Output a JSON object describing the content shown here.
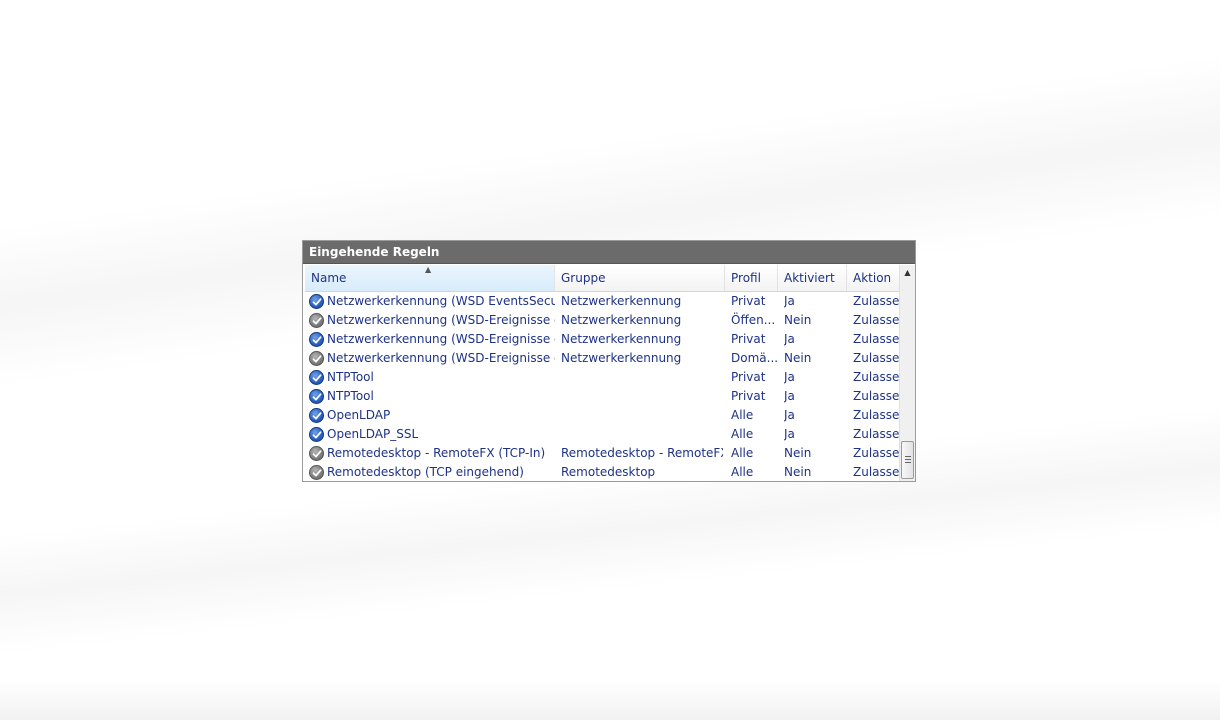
{
  "window": {
    "title": "Eingehende Regeln"
  },
  "columns": {
    "name": "Name",
    "group": "Gruppe",
    "profile": "Profil",
    "enabled": "Aktiviert",
    "action": "Aktion"
  },
  "rows": [
    {
      "name": "Netzwerkerkennung (WSD EventsSecure ...",
      "group": "Netzwerkerkennung",
      "profile": "Privat",
      "enabled": "Ja",
      "action": "Zulassen",
      "state": "enabled"
    },
    {
      "name": "Netzwerkerkennung (WSD-Ereignisse ein...",
      "group": "Netzwerkerkennung",
      "profile": "Öffen...",
      "enabled": "Nein",
      "action": "Zulassen",
      "state": "disabled"
    },
    {
      "name": "Netzwerkerkennung (WSD-Ereignisse ein...",
      "group": "Netzwerkerkennung",
      "profile": "Privat",
      "enabled": "Ja",
      "action": "Zulassen",
      "state": "enabled"
    },
    {
      "name": "Netzwerkerkennung (WSD-Ereignisse ein...",
      "group": "Netzwerkerkennung",
      "profile": "Domä...",
      "enabled": "Nein",
      "action": "Zulassen",
      "state": "disabled"
    },
    {
      "name": "NTPTool",
      "group": "",
      "profile": "Privat",
      "enabled": "Ja",
      "action": "Zulassen",
      "state": "enabled"
    },
    {
      "name": "NTPTool",
      "group": "",
      "profile": "Privat",
      "enabled": "Ja",
      "action": "Zulassen",
      "state": "enabled"
    },
    {
      "name": "OpenLDAP",
      "group": "",
      "profile": "Alle",
      "enabled": "Ja",
      "action": "Zulassen",
      "state": "enabled"
    },
    {
      "name": "OpenLDAP_SSL",
      "group": "",
      "profile": "Alle",
      "enabled": "Ja",
      "action": "Zulassen",
      "state": "enabled"
    },
    {
      "name": "Remotedesktop - RemoteFX (TCP-In)",
      "group": "Remotedesktop - RemoteFX",
      "profile": "Alle",
      "enabled": "Nein",
      "action": "Zulassen",
      "state": "disabled"
    },
    {
      "name": "Remotedesktop (TCP eingehend)",
      "group": "Remotedesktop",
      "profile": "Alle",
      "enabled": "Nein",
      "action": "Zulassen",
      "state": "disabled"
    }
  ],
  "icons": {
    "enabled": "check-circle-blue-icon",
    "disabled": "check-circle-gray-icon",
    "sort": "sort-ascending-icon"
  },
  "colors": {
    "title_bar": "#6b6b6b",
    "text": "#1e3287",
    "enabled_icon": "#2a5fbf",
    "disabled_icon": "#7c7c7c"
  }
}
